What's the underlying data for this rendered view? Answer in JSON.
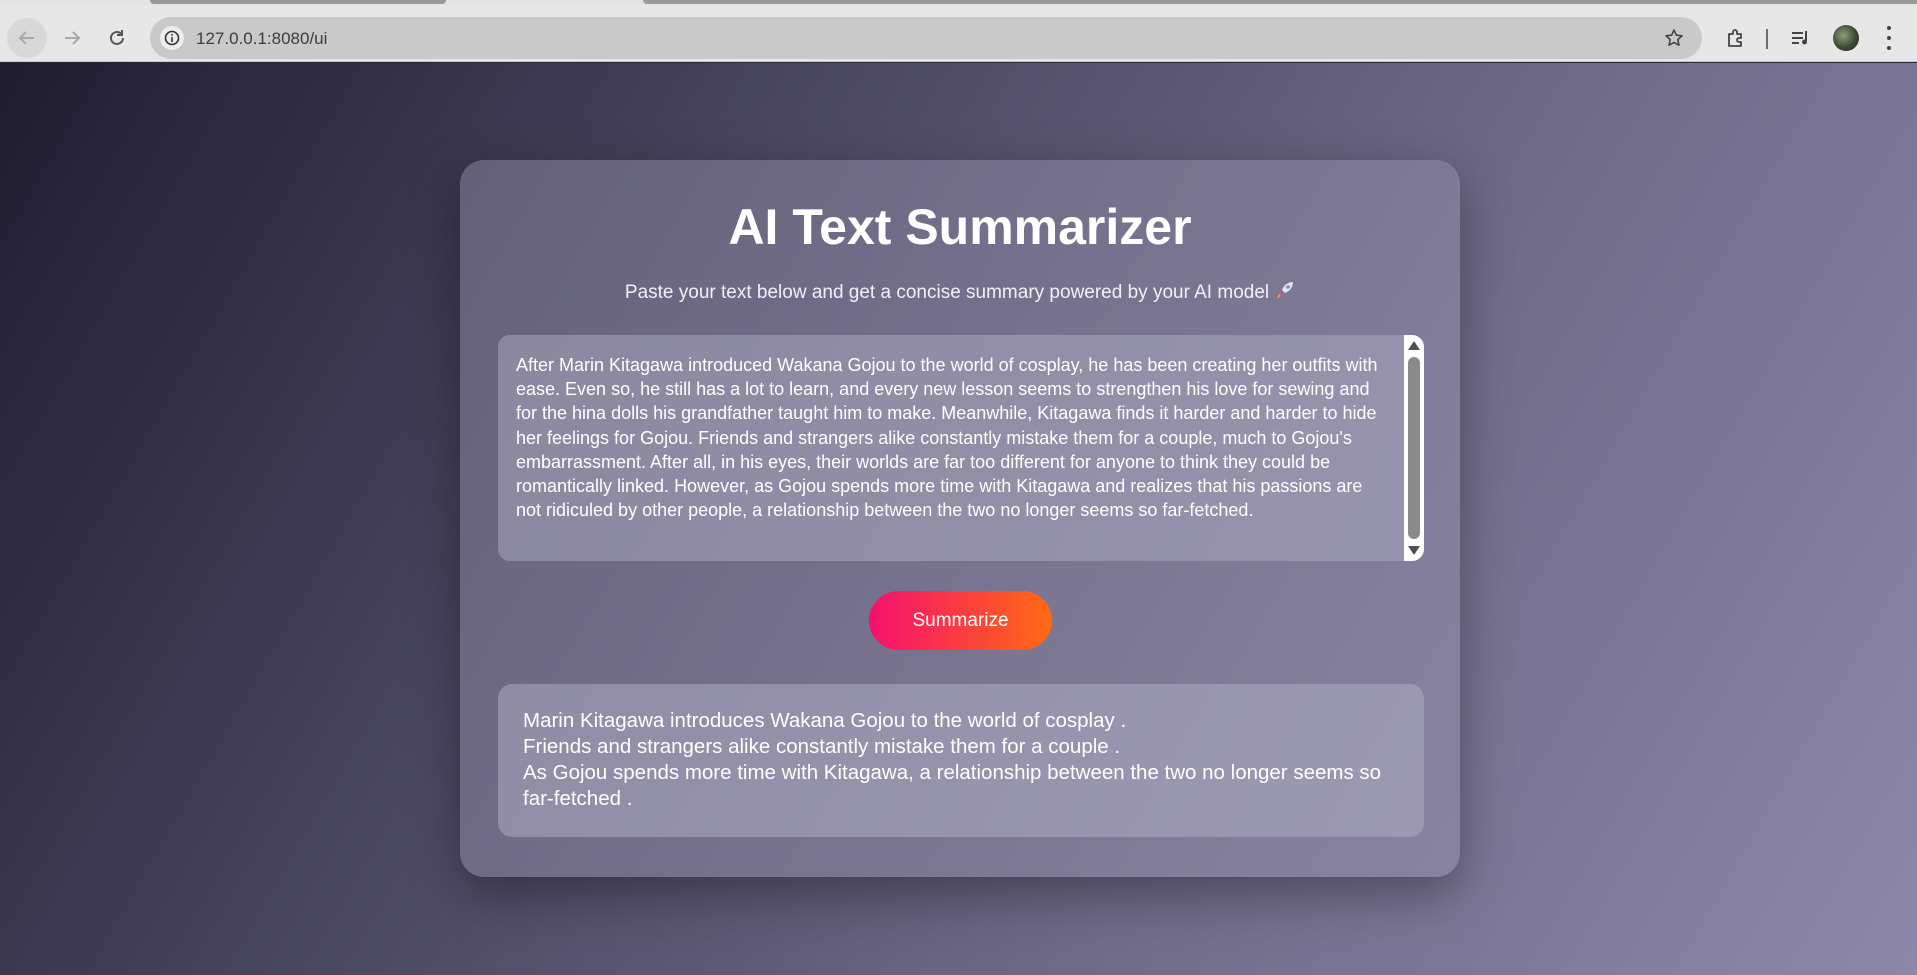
{
  "browser": {
    "url": "127.0.0.1:8080/ui"
  },
  "page": {
    "title": "AI Text Summarizer",
    "subtitle": "Paste your text below and get a concise summary powered by your AI model",
    "input_text": "After Marin Kitagawa introduced Wakana Gojou to the world of cosplay, he has been creating her outfits with ease. Even so, he still has a lot to learn, and every new lesson seems to strengthen his love for sewing and for the hina dolls his grandfather taught him to make. Meanwhile, Kitagawa finds it harder and harder to hide her feelings for Gojou. Friends and strangers alike constantly mistake them for a couple, much to Gojou's embarrassment. After all, in his eyes, their worlds are far too different for anyone to think they could be romantically linked. However, as Gojou spends more time with Kitagawa and realizes that his passions are not ridiculed by other people, a relationship between the two no longer seems so far-fetched.",
    "button_label": "Summarize",
    "summary": [
      "Marin Kitagawa introduces Wakana Gojou to the world of cosplay .",
      "Friends and strangers alike constantly mistake them for a couple .",
      "As Gojou spends more time with Kitagawa, a relationship between the two no longer seems so far-fetched ."
    ]
  },
  "colors": {
    "button_start": "#f5106e",
    "button_end": "#ff6a13"
  },
  "icons": {
    "subtitle_emoji": "rocket-icon"
  }
}
